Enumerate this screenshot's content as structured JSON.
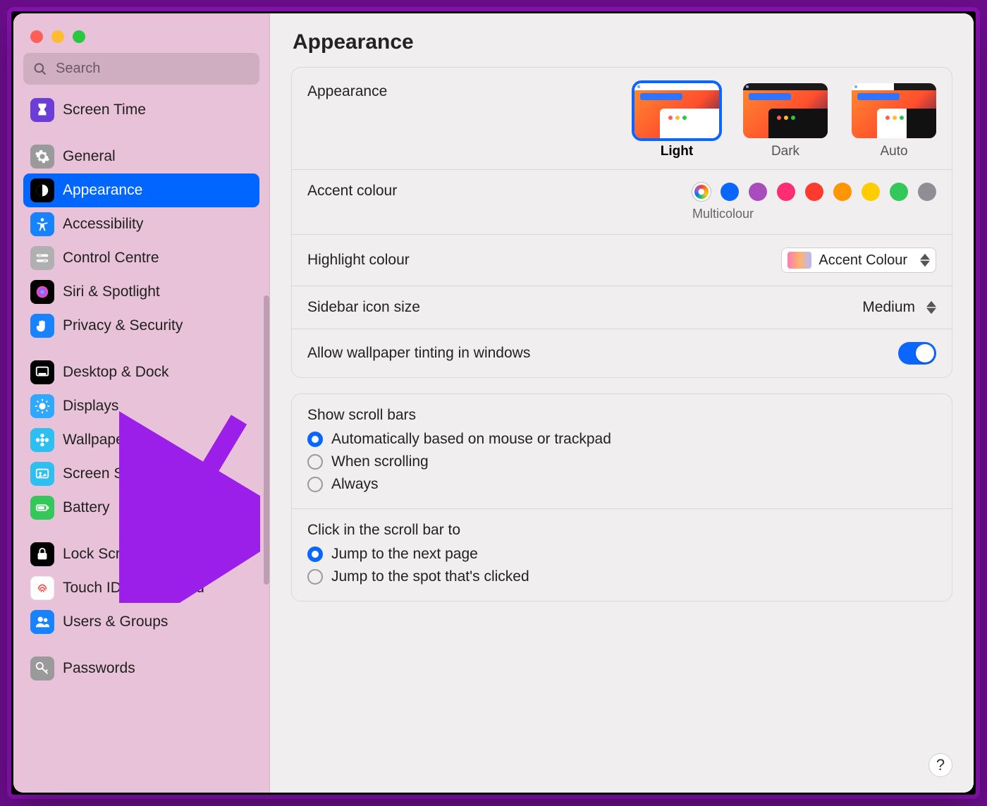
{
  "header": {
    "title": "Appearance"
  },
  "search": {
    "placeholder": "Search"
  },
  "sidebar": {
    "items": [
      {
        "label": "Screen Time"
      },
      {
        "label": "General"
      },
      {
        "label": "Appearance"
      },
      {
        "label": "Accessibility"
      },
      {
        "label": "Control Centre"
      },
      {
        "label": "Siri & Spotlight"
      },
      {
        "label": "Privacy & Security"
      },
      {
        "label": "Desktop & Dock"
      },
      {
        "label": "Displays"
      },
      {
        "label": "Wallpaper"
      },
      {
        "label": "Screen Saver"
      },
      {
        "label": "Battery"
      },
      {
        "label": "Lock Screen"
      },
      {
        "label": "Touch ID & Password"
      },
      {
        "label": "Users & Groups"
      },
      {
        "label": "Passwords"
      }
    ]
  },
  "appearance": {
    "section_label": "Appearance",
    "themes": {
      "light": "Light",
      "dark": "Dark",
      "auto": "Auto",
      "selected": "Light"
    },
    "accent": {
      "label": "Accent colour",
      "selected_label": "Multicolour",
      "colors": [
        "#0a66ff",
        "#a94dbd",
        "#ff2e74",
        "#ff3b30",
        "#ff9500",
        "#ffcc00",
        "#34c759",
        "#8e8e93"
      ]
    },
    "highlight": {
      "label": "Highlight colour",
      "value": "Accent Colour"
    },
    "sidebar_icon": {
      "label": "Sidebar icon size",
      "value": "Medium"
    },
    "tinting": {
      "label": "Allow wallpaper tinting in windows",
      "value": true
    }
  },
  "scroll": {
    "show_label": "Show scroll bars",
    "show_options": [
      "Automatically based on mouse or trackpad",
      "When scrolling",
      "Always"
    ],
    "show_selected": 0,
    "click_label": "Click in the scroll bar to",
    "click_options": [
      "Jump to the next page",
      "Jump to the spot that's clicked"
    ],
    "click_selected": 0
  },
  "help": {
    "label": "?"
  }
}
